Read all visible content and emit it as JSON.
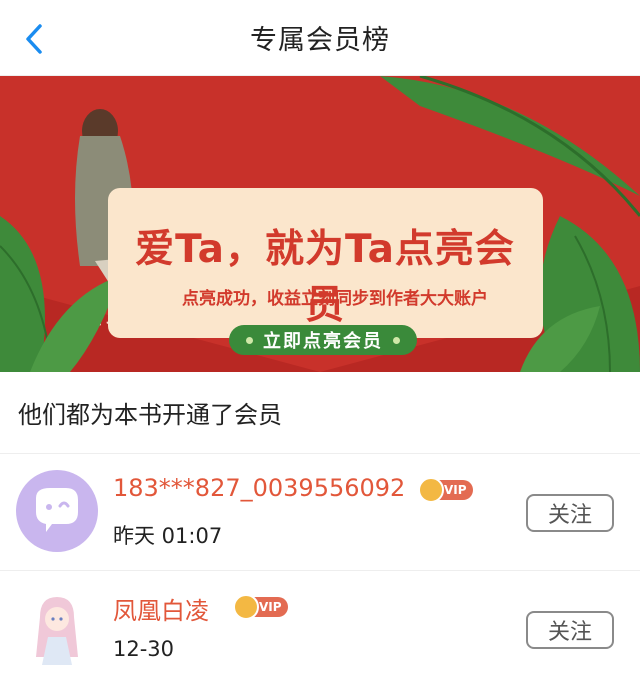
{
  "header": {
    "title": "专属会员榜",
    "back_icon": "chevron-left-icon",
    "accent": "#1a8cf0"
  },
  "banner": {
    "headline": "爱Ta，就为Ta点亮会员",
    "subline": "点亮成功，收益立刻同步到作者大大账户",
    "cta_label": "立即点亮会员",
    "bg_color": "#c8312a"
  },
  "section": {
    "title": "他们都为本书开通了会员"
  },
  "members": [
    {
      "name": "183***827_0039556092",
      "badge": "VIP",
      "time": "昨天 01:07",
      "follow_label": "关注"
    },
    {
      "name": "凤凰白凌",
      "badge": "VIP",
      "time": "12-30",
      "follow_label": "关注"
    }
  ]
}
